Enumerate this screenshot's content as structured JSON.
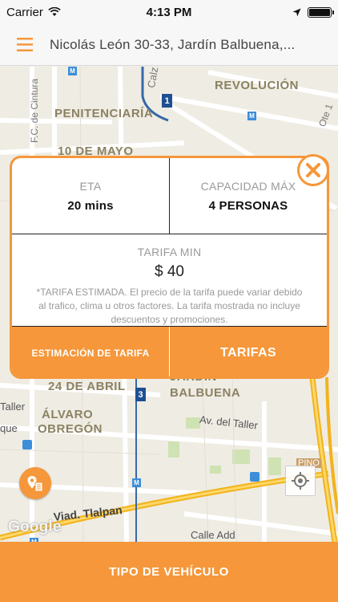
{
  "status": {
    "carrier": "Carrier",
    "time": "4:13 PM",
    "battery_level": 1.0
  },
  "header": {
    "address": "Nicolás León 30-33, Jardín Balbuena,..."
  },
  "map": {
    "labels": {
      "calz_gral": "Calz. Gral.",
      "revolucion": "REVOLUCIÓN",
      "penitenciaria": "PENITENCIARÍA",
      "fc_cintura": "F.C. de Cintura",
      "diez_mayo": "10 DE MAYO",
      "ote": "Ote 1",
      "calle": "Calle",
      "veinticuatro_abril": "24 DE ABRIL",
      "jardin": "JARDÍN",
      "balbuena": "BALBUENA",
      "alvaro": "ÁLVARO",
      "obregon": "OBREGÓN",
      "av_taller": "Av. del Taller",
      "taller": "Taller",
      "que": "que",
      "viad_tlalpan": "Viad. Tlalpan",
      "calle_add": "Calle Add",
      "pino": "PINO",
      "metro_1": "1",
      "metro_3": "3",
      "metro_m": "M"
    },
    "google": "Google"
  },
  "card": {
    "eta_label": "ETA",
    "eta_value": "20 mins",
    "capacity_label": "CAPACIDAD MÁX",
    "capacity_value": "4 PERSONAS",
    "fare_label": "TARIFA MIN",
    "fare_value": "$ 40",
    "disclaimer": "*TARIFA ESTIMADA. El precio de la tarifa puede variar debido al trafico, clima u otros factores. La tarifa mostrada no incluye descuentos y promociones.",
    "estimate_button": "ESTIMACIÓN DE TARIFA",
    "fares_button": "TARIFAS"
  },
  "bottom": {
    "vehicle_type_button": "TIPO DE VEHÍCULO"
  },
  "colors": {
    "accent": "#f5973a",
    "metro_blue": "#1f4f93",
    "highway": "#f2b31c"
  }
}
